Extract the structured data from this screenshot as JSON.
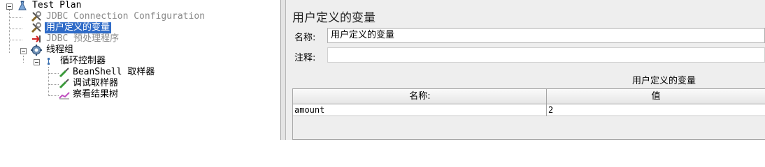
{
  "tree": {
    "items": [
      {
        "label": "Test Plan",
        "icon": "test-plan-icon"
      },
      {
        "label": "JDBC Connection Configuration",
        "icon": "wrench-icon",
        "state": "disabled"
      },
      {
        "label": "用户定义的变量",
        "icon": "wrench-icon",
        "state": "selected"
      },
      {
        "label": "JDBC 预处理程序",
        "icon": "preprocessor-arrow-icon",
        "state": "disabled"
      },
      {
        "label": "线程组",
        "icon": "gear-icon"
      },
      {
        "label": "循环控制器",
        "icon": "loop-controller-icon"
      },
      {
        "label": "BeanShell 取样器",
        "icon": "pipette-icon"
      },
      {
        "label": "调试取样器",
        "icon": "pipette-icon"
      },
      {
        "label": "察看结果树",
        "icon": "chart-icon"
      }
    ]
  },
  "editor": {
    "title": "用户定义的变量",
    "name_label": "名称:",
    "name_value": "用户定义的变量",
    "comment_label": "注释:",
    "comment_value": "",
    "group_caption": "用户定义的变量",
    "table": {
      "columns": [
        "名称:",
        "值"
      ],
      "rows": [
        {
          "name": "amount",
          "value": "2"
        }
      ]
    }
  },
  "colors": {
    "selection": "#2f6bc7",
    "disabled_text": "#8a8a8a",
    "panel_background": "#eeeeee"
  }
}
